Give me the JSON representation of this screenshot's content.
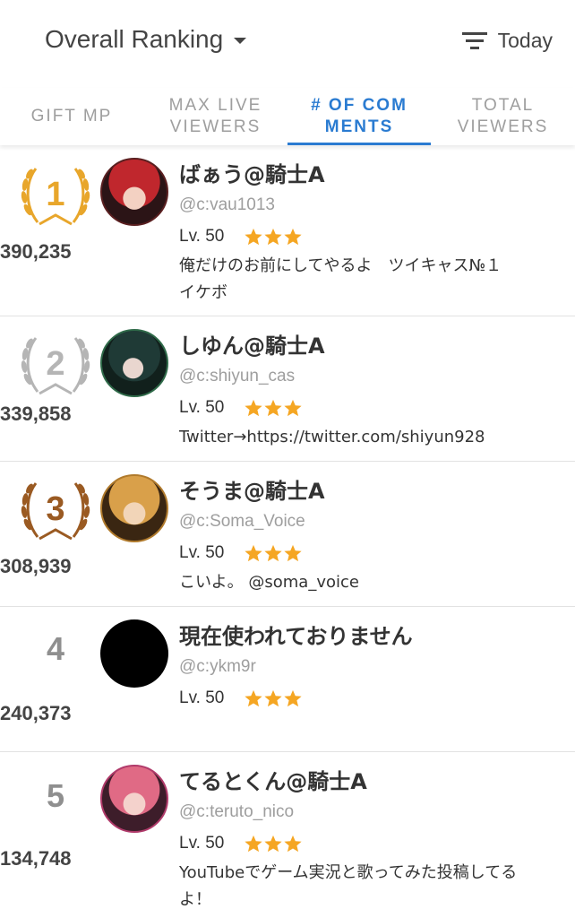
{
  "header": {
    "title": "Overall Ranking",
    "filter_label": "Today"
  },
  "tabs": [
    {
      "label": "GIFT MP",
      "active": false
    },
    {
      "label": "MAX LIVE VIEWERS",
      "active": false
    },
    {
      "label": "# OF COM MENTS",
      "active": true
    },
    {
      "label": "TOTAL VIEWERS",
      "active": false
    }
  ],
  "colors": {
    "accent": "#2a7bd1",
    "star": "#f5a623",
    "gold": "#e8a62b",
    "silver": "#b5b5b5",
    "bronze": "#9a5a22"
  },
  "rankings": [
    {
      "rank": "1",
      "score": "390,235",
      "name": "ばぁう@騎士A",
      "handle": "@c:vau1013",
      "level": "Lv. 50",
      "stars": 3,
      "bio": "俺だけのお前にしてやるよ　ツイキャス№１イケボ"
    },
    {
      "rank": "2",
      "score": "339,858",
      "name": "しゆん@騎士A",
      "handle": "@c:shiyun_cas",
      "level": "Lv. 50",
      "stars": 3,
      "bio": "Twitter→https://twitter.com/shiyun928"
    },
    {
      "rank": "3",
      "score": "308,939",
      "name": "そうま@騎士A",
      "handle": "@c:Soma_Voice",
      "level": "Lv. 50",
      "stars": 3,
      "bio": "こいよ。 @soma_voice"
    },
    {
      "rank": "4",
      "score": "240,373",
      "name": "現在使われておりません",
      "handle": "@c:ykm9r",
      "level": "Lv. 50",
      "stars": 3,
      "bio": ""
    },
    {
      "rank": "5",
      "score": "134,748",
      "name": "てるとくん@騎士A",
      "handle": "@c:teruto_nico",
      "level": "Lv. 50",
      "stars": 3,
      "bio": "YouTubeでゲーム実況と歌ってみた投稿してるよ！"
    }
  ]
}
